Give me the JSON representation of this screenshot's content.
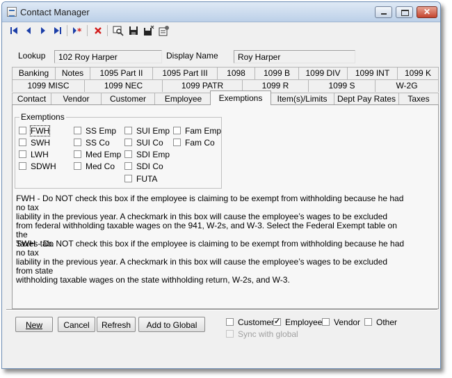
{
  "window": {
    "title": "Contact Manager",
    "close_glyph": "✕"
  },
  "toolbar": {
    "icons": [
      "first-record-icon",
      "previous-record-icon",
      "next-record-icon",
      "last-record-icon",
      "new-record-icon",
      "delete-icon",
      "find-icon",
      "save-icon",
      "save-close-icon",
      "properties-icon"
    ]
  },
  "lookup": {
    "label": "Lookup",
    "value": "102 Roy Harper"
  },
  "display_name": {
    "label": "Display Name",
    "value": "Roy Harper"
  },
  "tabs": {
    "row1": [
      "Banking",
      "Notes",
      "1095 Part II",
      "1095 Part III",
      "1098",
      "1099 B",
      "1099 DIV",
      "1099 INT",
      "1099 K"
    ],
    "row2": [
      "1099 MISC",
      "1099 NEC",
      "1099 PATR",
      "1099 R",
      "1099 S",
      "W-2G"
    ],
    "row3": [
      "Contact",
      "Vendor",
      "Customer",
      "Employee",
      "Exemptions",
      "Item(s)/Limits",
      "Dept Pay Rates",
      "Taxes"
    ],
    "active": "Exemptions"
  },
  "exemptions": {
    "group_label": "Exemptions",
    "col1": [
      "FWH",
      "SWH",
      "LWH",
      "SDWH"
    ],
    "col2": [
      "SS Emp",
      "SS Co",
      "Med Emp",
      "Med Co"
    ],
    "col3": [
      "SUI Emp",
      "SUI Co",
      "SDI Emp",
      "SDI Co",
      "FUTA"
    ],
    "col4": [
      "Fam Emp",
      "Fam Co"
    ]
  },
  "descriptions": {
    "fwh": "FWH - Do NOT check this box if the employee is claiming to be exempt from withholding because he had no tax\nliability in the previous year. A checkmark in this box will cause the employee’s wages to be excluded\nfrom federal withholding taxable wages on the 941, W-2s, and W-3. Select the Federal Exempt table on the\nTaxes tab.",
    "swh": "SWH - Do NOT check this box if the employee is claiming to be exempt from withholding because he had no tax\nliability in the previous year. A checkmark in this box will cause the employee’s wages to be excluded from state\nwithholding taxable wages on the state withholding return, W-2s, and W-3."
  },
  "buttons": {
    "new": "New",
    "cancel": "Cancel",
    "refresh": "Refresh",
    "add_to_global": "Add to Global"
  },
  "contact_types": [
    {
      "label": "Customer",
      "checked": false
    },
    {
      "label": "Employee",
      "checked": true
    },
    {
      "label": "Vendor",
      "checked": false
    },
    {
      "label": "Other",
      "checked": false
    }
  ],
  "sync_with_global": {
    "label": "Sync with global",
    "checked": false,
    "enabled": false
  }
}
